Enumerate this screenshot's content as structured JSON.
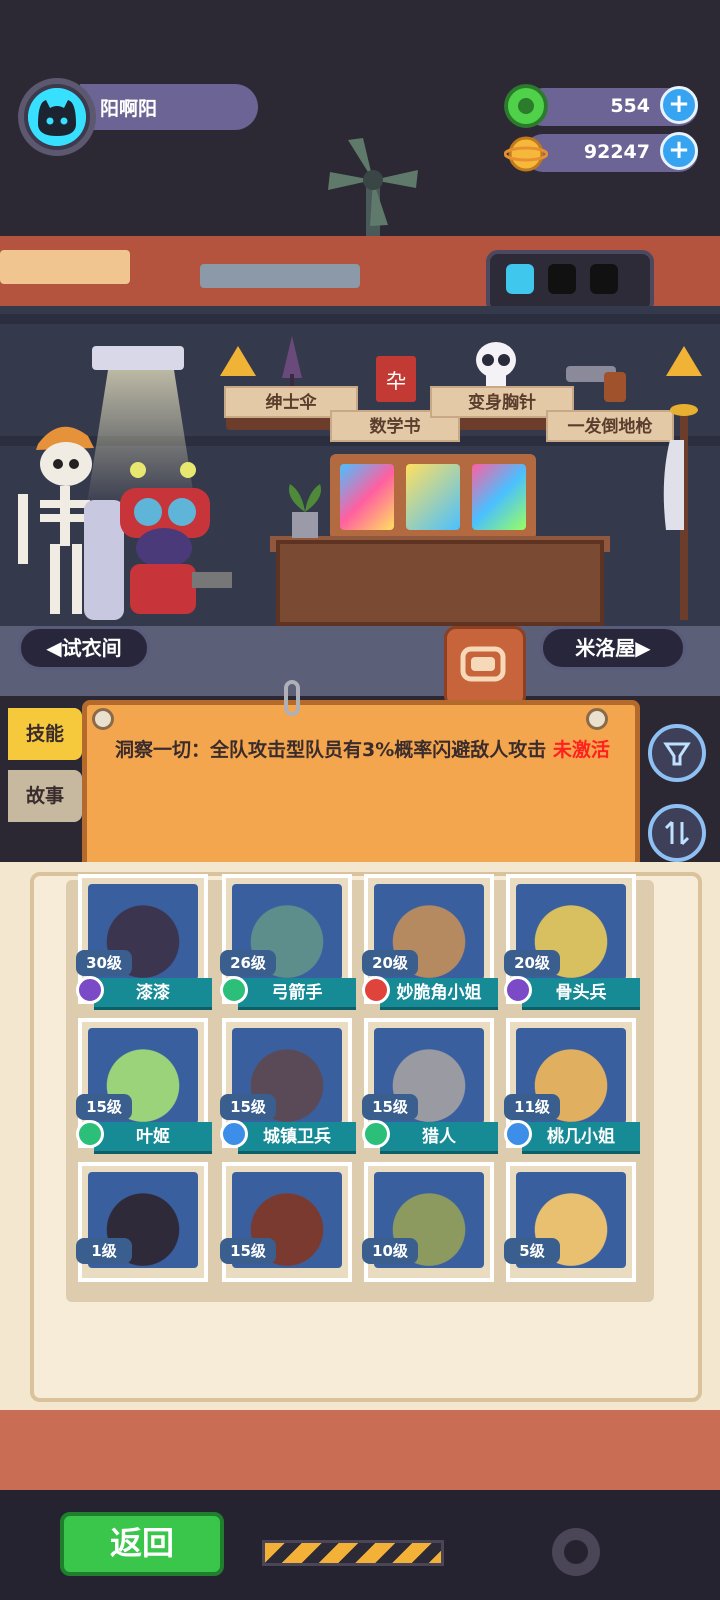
{
  "profile": {
    "name": "阳啊阳",
    "avatar_icon": "cat-avatar-icon"
  },
  "currencies": [
    {
      "icon": "green-gem-coin-icon",
      "value": "554",
      "plus": "+"
    },
    {
      "icon": "gold-planet-coin-icon",
      "value": "92247",
      "plus": "+"
    }
  ],
  "battery": {
    "cells": 3,
    "charged": 1
  },
  "items": [
    {
      "label": "绅士伞"
    },
    {
      "label": "数学书"
    },
    {
      "label": "变身胸针"
    },
    {
      "label": "一发倒地枪"
    }
  ],
  "nav": {
    "left": "◀试衣间",
    "right": "米洛屋▶"
  },
  "tabs": {
    "skill": "技能",
    "story": "故事"
  },
  "skill": {
    "text": "洞察一切：全队攻击型队员有3%概率闪避敌人攻击",
    "status": "未激活"
  },
  "heroes": [
    {
      "level": "30级",
      "name": "漆漆",
      "elem_color": "#7a4ac7",
      "color": "#3b3550"
    },
    {
      "level": "26级",
      "name": "弓箭手",
      "elem_color": "#2bbf7a",
      "color": "#5e8e8c"
    },
    {
      "level": "20级",
      "name": "妙脆角小姐",
      "elem_color": "#e0433b",
      "color": "#b68a60"
    },
    {
      "level": "20级",
      "name": "骨头兵",
      "elem_color": "#7a4ac7",
      "color": "#d8c060"
    },
    {
      "level": "15级",
      "name": "叶姬",
      "elem_color": "#2bbf7a",
      "color": "#9ad37a"
    },
    {
      "level": "15级",
      "name": "城镇卫兵",
      "elem_color": "#3d8ee8",
      "color": "#5a4a58"
    },
    {
      "level": "15级",
      "name": "猎人",
      "elem_color": "#2bbf7a",
      "color": "#9a9aa2"
    },
    {
      "level": "11级",
      "name": "桃几小姐",
      "elem_color": "#3d8ee8",
      "color": "#e0b060"
    },
    {
      "level": "1级",
      "name": "",
      "elem_color": "",
      "color": "#2f2a3a"
    },
    {
      "level": "15级",
      "name": "",
      "elem_color": "",
      "color": "#7a3a30"
    },
    {
      "level": "10级",
      "name": "",
      "elem_color": "",
      "color": "#8c9a60"
    },
    {
      "level": "5级",
      "name": "",
      "elem_color": "",
      "color": "#e8c070"
    }
  ],
  "back_button": "返回"
}
